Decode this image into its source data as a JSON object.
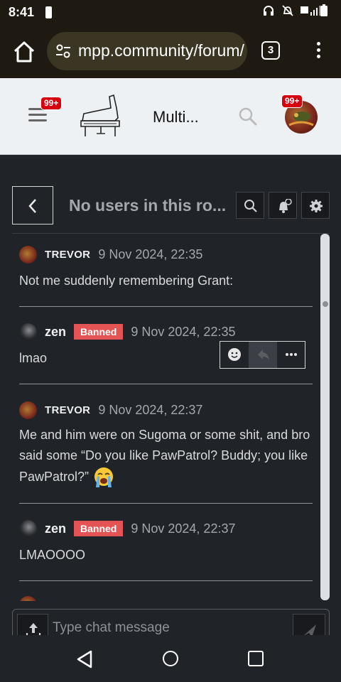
{
  "status_bar": {
    "time": "8:41"
  },
  "browser": {
    "url": "mpp.community/forum/",
    "tab_count": "3"
  },
  "site": {
    "menu_badge": "99+",
    "title": "Multi...",
    "avatar_badge": "99+"
  },
  "chat": {
    "room_title": "No users in this ro...",
    "messages": [
      {
        "author": "TREVOR",
        "banned": "",
        "time": "9 Nov 2024, 22:35",
        "text": "Not me suddenly remembering Grant:"
      },
      {
        "author": "zen",
        "banned": "Banned",
        "time": "9 Nov 2024, 22:35",
        "text": "lmao"
      },
      {
        "author": "TREVOR",
        "banned": "",
        "time": "9 Nov 2024, 22:37",
        "text": "Me and him were on Sugoma or some shit, and bro said some “Do you like PawPatrol? Buddy; you like PawPatrol?”"
      },
      {
        "author": "zen",
        "banned": "Banned",
        "time": "9 Nov 2024, 22:37",
        "text": "LMAOOOO"
      }
    ],
    "composer_placeholder": "Type chat message"
  },
  "icons": {
    "home": "home-icon",
    "tune": "tune-icon",
    "search": "search-icon",
    "back": "chevron-left-icon",
    "bell": "bell-icon",
    "gear": "gear-icon",
    "smile": "smile-icon",
    "reply": "reply-icon",
    "more": "more-horizontal-icon",
    "upload": "upload-icon",
    "send": "send-icon",
    "crying_emoji": "loudly-crying-face-icon"
  },
  "colors": {
    "banned": "#e45454",
    "badge": "#d6000f",
    "background": "#202327",
    "header": "#edf1f4"
  }
}
